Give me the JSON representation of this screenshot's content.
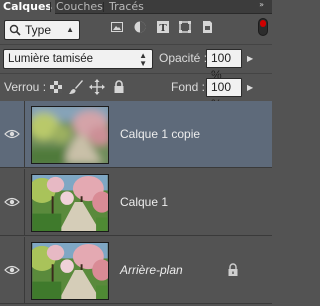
{
  "tabs": [
    {
      "label": "Calques",
      "active": true
    },
    {
      "label": "Couches",
      "active": false
    },
    {
      "label": "Tracés",
      "active": false
    }
  ],
  "filter": {
    "search_icon": "search-icon",
    "kind_label": "Type",
    "filter_icons": [
      "image-filter-icon",
      "adjustment-filter-icon",
      "type-filter-icon",
      "shape-filter-icon",
      "smart-object-filter-icon"
    ],
    "filter_enabled": true
  },
  "blend": {
    "mode": "Lumière tamisée",
    "opacity_label": "Opacité :",
    "opacity_value": "100 %"
  },
  "lock": {
    "label": "Verrou :",
    "icons": [
      "lock-transparent-icon",
      "lock-image-icon",
      "lock-position-icon",
      "lock-all-icon"
    ],
    "fill_label": "Fond :",
    "fill_value": "100 %"
  },
  "layers": [
    {
      "name": "Calque 1 copie",
      "selected": true,
      "visible": true,
      "italic": false,
      "locked": false,
      "thumbnail": "blurred-garden-path"
    },
    {
      "name": "Calque 1",
      "selected": false,
      "visible": true,
      "italic": false,
      "locked": false,
      "thumbnail": "garden-path"
    },
    {
      "name": "Arrière-plan",
      "selected": false,
      "visible": true,
      "italic": true,
      "locked": true,
      "thumbnail": "garden-path"
    }
  ],
  "colors": {
    "panel_bg": "#535353",
    "selected_row": "#5e6a7a",
    "filter_toggle_on": "#d00000"
  }
}
